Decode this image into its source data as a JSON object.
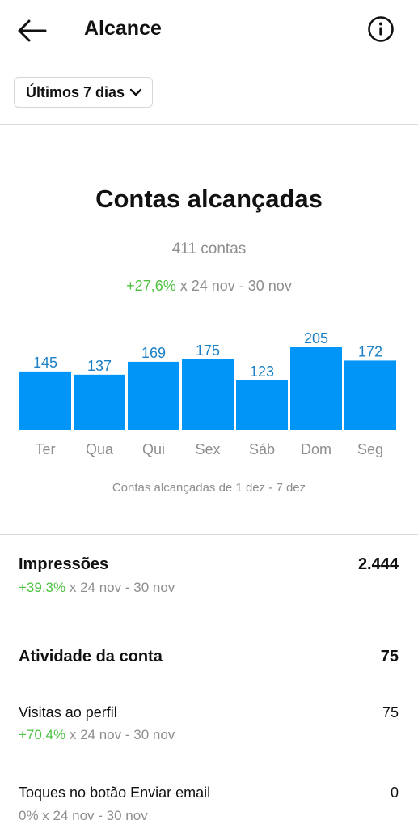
{
  "header": {
    "title": "Alcance",
    "back_icon": "arrow-left-icon",
    "info_icon": "info-circle-icon"
  },
  "filter": {
    "label": "Últimos 7 dias"
  },
  "reach": {
    "title": "Contas alcançadas",
    "count": "411 contas",
    "change": "+27,6%",
    "change_period": " x 24 nov - 30 nov",
    "caption": "Contas alcançadas de 1 dez - 7 dez"
  },
  "chart_data": {
    "type": "bar",
    "categories": [
      "Ter",
      "Qua",
      "Qui",
      "Sex",
      "Sáb",
      "Dom",
      "Seg"
    ],
    "values": [
      145,
      137,
      169,
      175,
      123,
      205,
      172
    ],
    "ylim": [
      0,
      205
    ],
    "grid": false,
    "bar_color": "#0095f6",
    "label_color": "#1a7fc4"
  },
  "impressions": {
    "label": "Impressões",
    "value": "2.444",
    "change": "+39,3%",
    "change_period": " x 24 nov - 30 nov"
  },
  "activity": {
    "label": "Atividade da conta",
    "value": "75",
    "items": [
      {
        "label": "Visitas ao perfil",
        "value": "75",
        "change": "+70,4%",
        "change_period": " x 24 nov - 30 nov"
      },
      {
        "label": "Toques no botão Enviar email",
        "value": "0",
        "change": "",
        "change_period": "0% x 24 nov - 30 nov"
      }
    ]
  },
  "colors": {
    "green": "#4fc244",
    "gray": "#8e8e8e",
    "accent": "#0095f6"
  }
}
